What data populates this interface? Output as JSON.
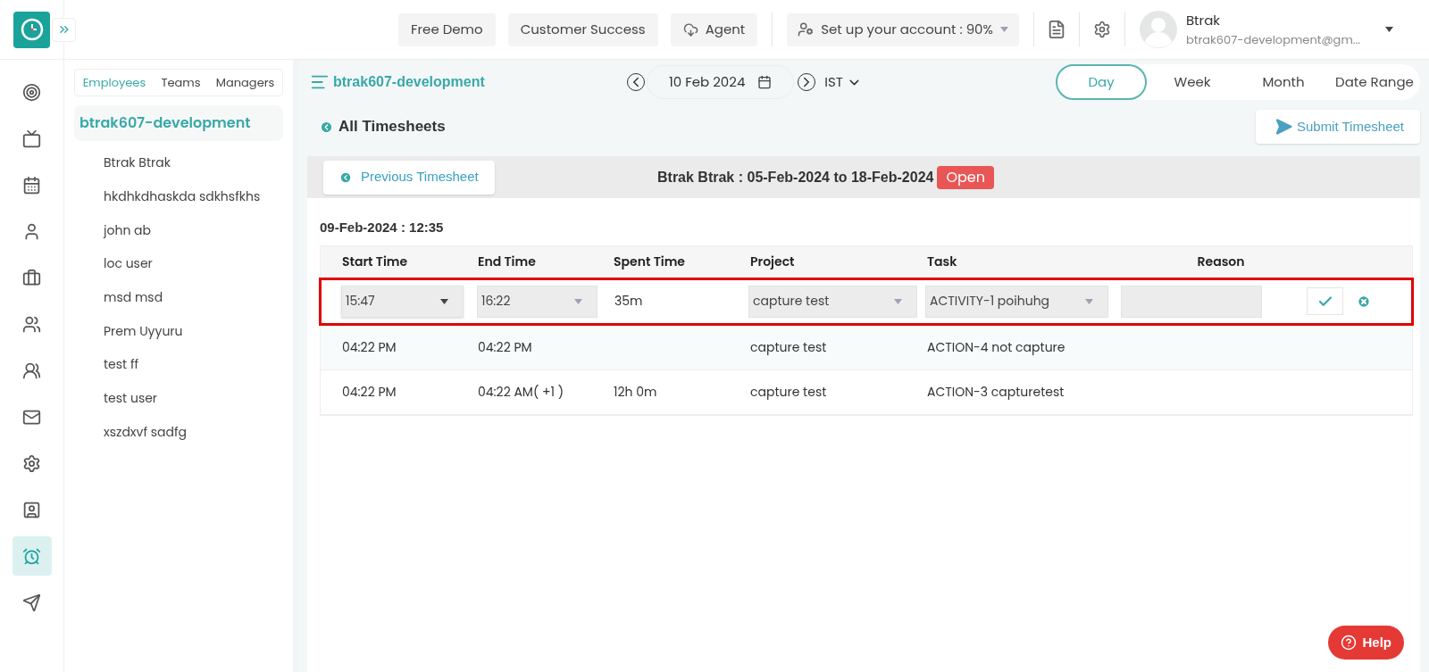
{
  "topbar": {
    "buttons": [
      {
        "label": "Free Demo",
        "kind": "plain"
      },
      {
        "label": "Customer Success",
        "kind": "plain"
      },
      {
        "label": "Agent",
        "kind": "cloud"
      }
    ],
    "setup": "Set up your account : 90%",
    "user": {
      "name": "Btrak",
      "email": "btrak607-development@gm..."
    }
  },
  "nav": [
    {
      "kind": "target",
      "selected": false
    },
    {
      "kind": "tv",
      "selected": false
    },
    {
      "kind": "calendar",
      "selected": false
    },
    {
      "kind": "user",
      "selected": false
    },
    {
      "kind": "briefcase",
      "selected": false
    },
    {
      "kind": "users",
      "selected": false
    },
    {
      "kind": "group",
      "selected": false
    },
    {
      "kind": "mail",
      "selected": false
    },
    {
      "kind": "settings",
      "selected": false
    },
    {
      "kind": "contact",
      "selected": false
    },
    {
      "kind": "alarm",
      "selected": true
    },
    {
      "kind": "send",
      "selected": false
    }
  ],
  "people_tabs": [
    {
      "label": "Employees",
      "selected": true
    },
    {
      "label": "Teams",
      "selected": false
    },
    {
      "label": "Managers",
      "selected": false
    }
  ],
  "team": {
    "name": "btrak607-development",
    "members": [
      "Btrak Btrak",
      "hkdhkdhaskda sdkhsfkhs",
      "john ab",
      "loc user",
      "msd msd",
      "Prem Uyyuru",
      "test ff",
      "test user",
      "xszdxvf sadfg"
    ]
  },
  "header": {
    "title": "btrak607-development",
    "date": "10 Feb 2024",
    "timezone": "IST",
    "views": [
      {
        "label": "Day",
        "selected": true
      },
      {
        "label": "Week",
        "selected": false
      },
      {
        "label": "Month",
        "selected": false
      },
      {
        "label": "Date Range",
        "selected": false
      }
    ]
  },
  "back_link": "All Timesheets",
  "submit_button": "Submit Timesheet",
  "sheet": {
    "previous_button": "Previous Timesheet",
    "title": "Btrak Btrak : 05-Feb-2024 to 18-Feb-2024",
    "status": "Open",
    "date_heading": "09-Feb-2024 : 12:35",
    "columns": [
      "Start Time",
      "End Time",
      "Spent Time",
      "Project",
      "Task",
      "Reason"
    ],
    "rows": [
      {
        "kind": "edit",
        "highlighted": true,
        "start": "15:47",
        "end": "16:22",
        "spent": "35m",
        "project": "capture test",
        "task": "ACTIVITY-1 poihuhg"
      },
      {
        "kind": "entry",
        "start": "04:22 PM",
        "end": "04:22 PM",
        "project": "capture test",
        "task": "ACTION-4 not capture"
      },
      {
        "kind": "entry",
        "start": "04:22 PM",
        "end": "04:22 AM( +1 )",
        "spent": "12h 0m",
        "project": "capture test",
        "task": "ACTION-3 capturetest"
      }
    ]
  },
  "help_button": "Help"
}
